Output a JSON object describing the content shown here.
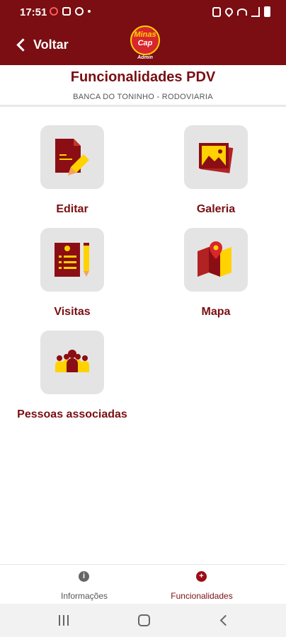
{
  "status_bar": {
    "time": "17:51"
  },
  "app_bar": {
    "back_label": "Voltar",
    "logo": {
      "line1": "Minas",
      "line2": "Cap",
      "subtitle": "Admin"
    }
  },
  "header": {
    "title": "Funcionalidades PDV",
    "subtitle": "BANCA DO TONINHO - RODOVIARIA"
  },
  "features": [
    {
      "label": "Editar",
      "icon": "edit-document-icon"
    },
    {
      "label": "Galeria",
      "icon": "gallery-icon"
    },
    {
      "label": "Visitas",
      "icon": "visits-clipboard-icon"
    },
    {
      "label": "Mapa",
      "icon": "map-icon"
    },
    {
      "label": "Pessoas associadas",
      "icon": "people-icon"
    }
  ],
  "bottom_nav": [
    {
      "label": "Informações",
      "icon": "info-icon",
      "active": false,
      "glyph": "i"
    },
    {
      "label": "Funcionalidades",
      "icon": "plus-icon",
      "active": true,
      "glyph": "+"
    }
  ],
  "colors": {
    "primary": "#7a0e12",
    "accent_yellow": "#ffd200",
    "tile_bg": "#e4e4e4"
  }
}
